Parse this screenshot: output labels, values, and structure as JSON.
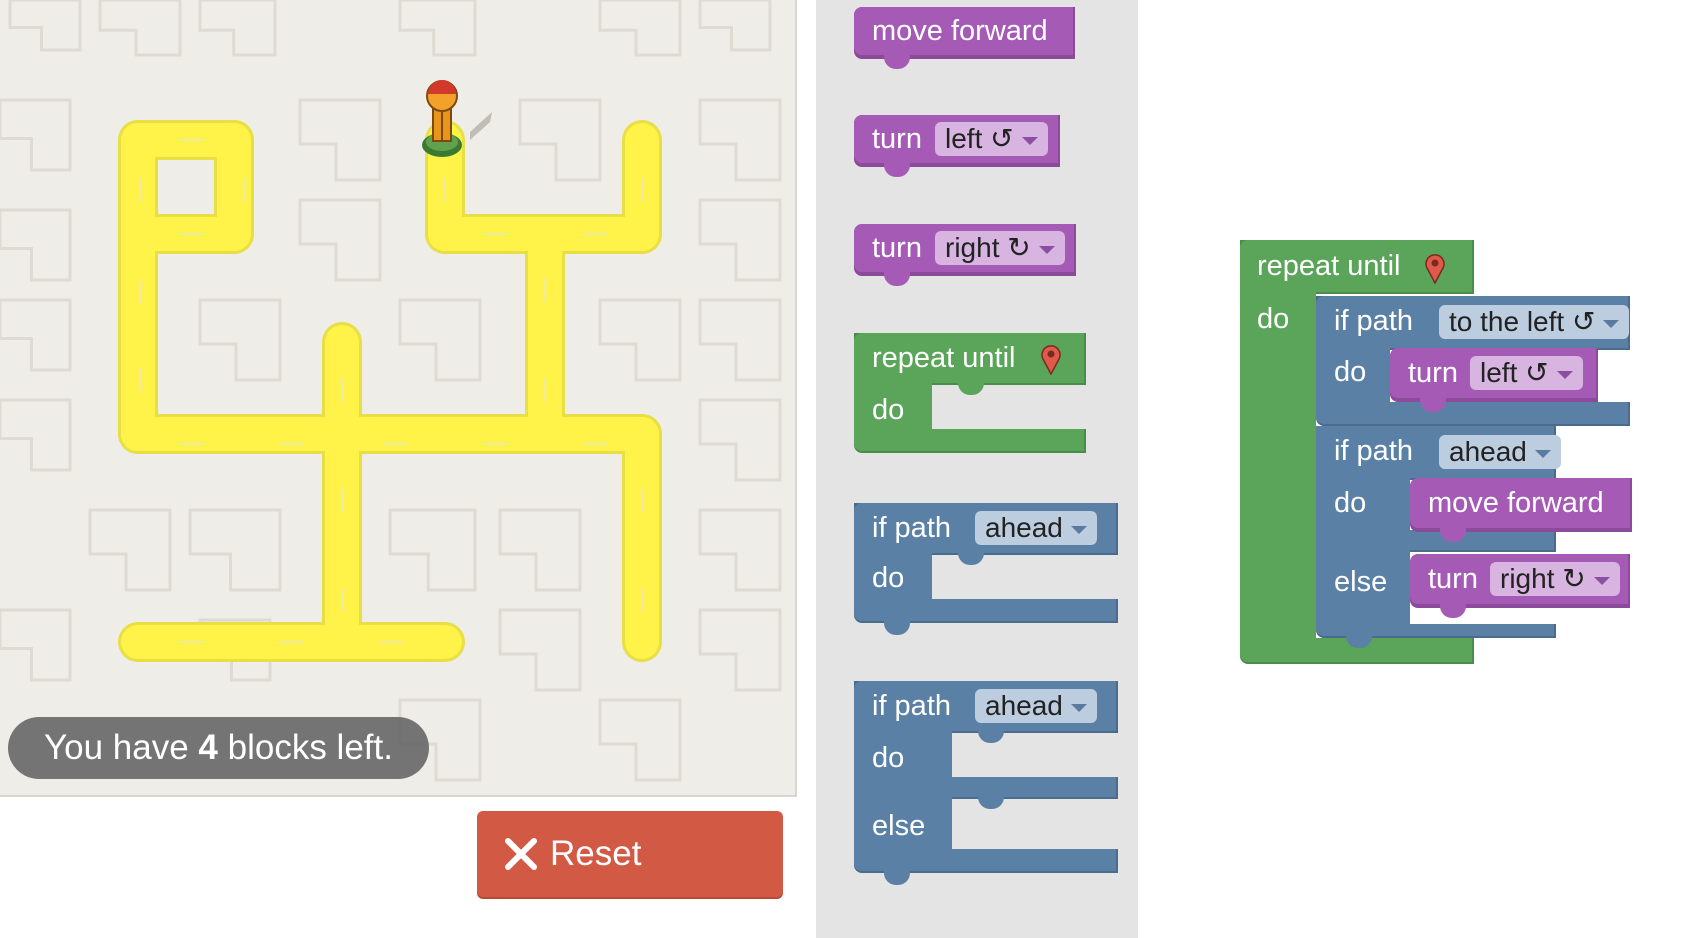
{
  "status": {
    "prefix": "You have ",
    "count": "4",
    "suffix": " blocks left."
  },
  "reset_label": "Reset",
  "colors": {
    "motion": "#a55bb6",
    "loop": "#5ba55b",
    "logic": "#5b80a5",
    "path": "#fff34a",
    "reset": "#d25a44"
  },
  "toolbox": {
    "move_forward": "move forward",
    "turn": "turn",
    "left": "left ↺",
    "right": "right ↻",
    "repeat_until": "repeat until",
    "do": "do",
    "if_path": "if path",
    "ahead": "ahead",
    "else": "else"
  },
  "workspace": {
    "repeat_until": "repeat until",
    "do": "do",
    "if_path": "if path",
    "to_the_left": "to the left ↺",
    "turn": "turn",
    "left": "left ↺",
    "ahead": "ahead",
    "move_forward": "move forward",
    "else": "else",
    "right": "right ↻"
  },
  "icons": {
    "goal": "map-marker-icon",
    "avatar": "pegman-icon",
    "reset": "x-icon"
  }
}
